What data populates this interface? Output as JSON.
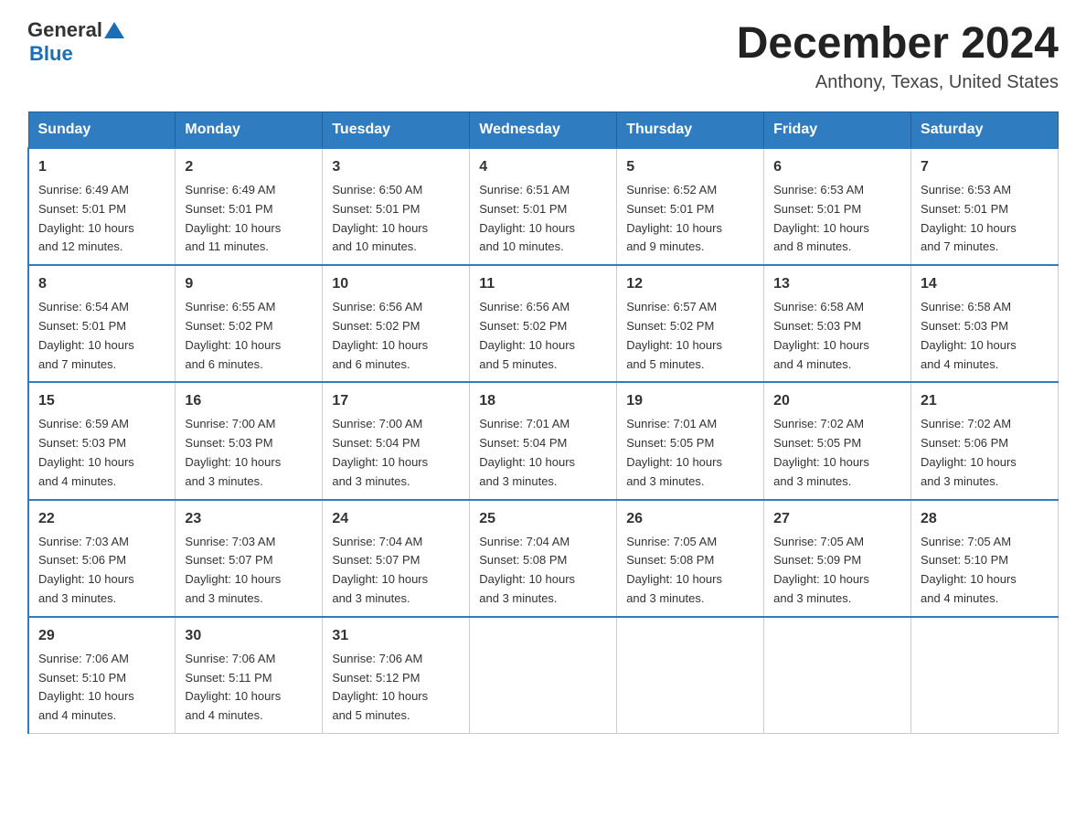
{
  "header": {
    "logo_general": "General",
    "logo_blue": "Blue",
    "month_year": "December 2024",
    "location": "Anthony, Texas, United States"
  },
  "days_of_week": [
    "Sunday",
    "Monday",
    "Tuesday",
    "Wednesday",
    "Thursday",
    "Friday",
    "Saturday"
  ],
  "weeks": [
    [
      {
        "day": "1",
        "sunrise": "6:49 AM",
        "sunset": "5:01 PM",
        "daylight": "10 hours and 12 minutes."
      },
      {
        "day": "2",
        "sunrise": "6:49 AM",
        "sunset": "5:01 PM",
        "daylight": "10 hours and 11 minutes."
      },
      {
        "day": "3",
        "sunrise": "6:50 AM",
        "sunset": "5:01 PM",
        "daylight": "10 hours and 10 minutes."
      },
      {
        "day": "4",
        "sunrise": "6:51 AM",
        "sunset": "5:01 PM",
        "daylight": "10 hours and 10 minutes."
      },
      {
        "day": "5",
        "sunrise": "6:52 AM",
        "sunset": "5:01 PM",
        "daylight": "10 hours and 9 minutes."
      },
      {
        "day": "6",
        "sunrise": "6:53 AM",
        "sunset": "5:01 PM",
        "daylight": "10 hours and 8 minutes."
      },
      {
        "day": "7",
        "sunrise": "6:53 AM",
        "sunset": "5:01 PM",
        "daylight": "10 hours and 7 minutes."
      }
    ],
    [
      {
        "day": "8",
        "sunrise": "6:54 AM",
        "sunset": "5:01 PM",
        "daylight": "10 hours and 7 minutes."
      },
      {
        "day": "9",
        "sunrise": "6:55 AM",
        "sunset": "5:02 PM",
        "daylight": "10 hours and 6 minutes."
      },
      {
        "day": "10",
        "sunrise": "6:56 AM",
        "sunset": "5:02 PM",
        "daylight": "10 hours and 6 minutes."
      },
      {
        "day": "11",
        "sunrise": "6:56 AM",
        "sunset": "5:02 PM",
        "daylight": "10 hours and 5 minutes."
      },
      {
        "day": "12",
        "sunrise": "6:57 AM",
        "sunset": "5:02 PM",
        "daylight": "10 hours and 5 minutes."
      },
      {
        "day": "13",
        "sunrise": "6:58 AM",
        "sunset": "5:03 PM",
        "daylight": "10 hours and 4 minutes."
      },
      {
        "day": "14",
        "sunrise": "6:58 AM",
        "sunset": "5:03 PM",
        "daylight": "10 hours and 4 minutes."
      }
    ],
    [
      {
        "day": "15",
        "sunrise": "6:59 AM",
        "sunset": "5:03 PM",
        "daylight": "10 hours and 4 minutes."
      },
      {
        "day": "16",
        "sunrise": "7:00 AM",
        "sunset": "5:03 PM",
        "daylight": "10 hours and 3 minutes."
      },
      {
        "day": "17",
        "sunrise": "7:00 AM",
        "sunset": "5:04 PM",
        "daylight": "10 hours and 3 minutes."
      },
      {
        "day": "18",
        "sunrise": "7:01 AM",
        "sunset": "5:04 PM",
        "daylight": "10 hours and 3 minutes."
      },
      {
        "day": "19",
        "sunrise": "7:01 AM",
        "sunset": "5:05 PM",
        "daylight": "10 hours and 3 minutes."
      },
      {
        "day": "20",
        "sunrise": "7:02 AM",
        "sunset": "5:05 PM",
        "daylight": "10 hours and 3 minutes."
      },
      {
        "day": "21",
        "sunrise": "7:02 AM",
        "sunset": "5:06 PM",
        "daylight": "10 hours and 3 minutes."
      }
    ],
    [
      {
        "day": "22",
        "sunrise": "7:03 AM",
        "sunset": "5:06 PM",
        "daylight": "10 hours and 3 minutes."
      },
      {
        "day": "23",
        "sunrise": "7:03 AM",
        "sunset": "5:07 PM",
        "daylight": "10 hours and 3 minutes."
      },
      {
        "day": "24",
        "sunrise": "7:04 AM",
        "sunset": "5:07 PM",
        "daylight": "10 hours and 3 minutes."
      },
      {
        "day": "25",
        "sunrise": "7:04 AM",
        "sunset": "5:08 PM",
        "daylight": "10 hours and 3 minutes."
      },
      {
        "day": "26",
        "sunrise": "7:05 AM",
        "sunset": "5:08 PM",
        "daylight": "10 hours and 3 minutes."
      },
      {
        "day": "27",
        "sunrise": "7:05 AM",
        "sunset": "5:09 PM",
        "daylight": "10 hours and 3 minutes."
      },
      {
        "day": "28",
        "sunrise": "7:05 AM",
        "sunset": "5:10 PM",
        "daylight": "10 hours and 4 minutes."
      }
    ],
    [
      {
        "day": "29",
        "sunrise": "7:06 AM",
        "sunset": "5:10 PM",
        "daylight": "10 hours and 4 minutes."
      },
      {
        "day": "30",
        "sunrise": "7:06 AM",
        "sunset": "5:11 PM",
        "daylight": "10 hours and 4 minutes."
      },
      {
        "day": "31",
        "sunrise": "7:06 AM",
        "sunset": "5:12 PM",
        "daylight": "10 hours and 5 minutes."
      },
      null,
      null,
      null,
      null
    ]
  ],
  "labels": {
    "sunrise": "Sunrise:",
    "sunset": "Sunset:",
    "daylight": "Daylight:"
  }
}
